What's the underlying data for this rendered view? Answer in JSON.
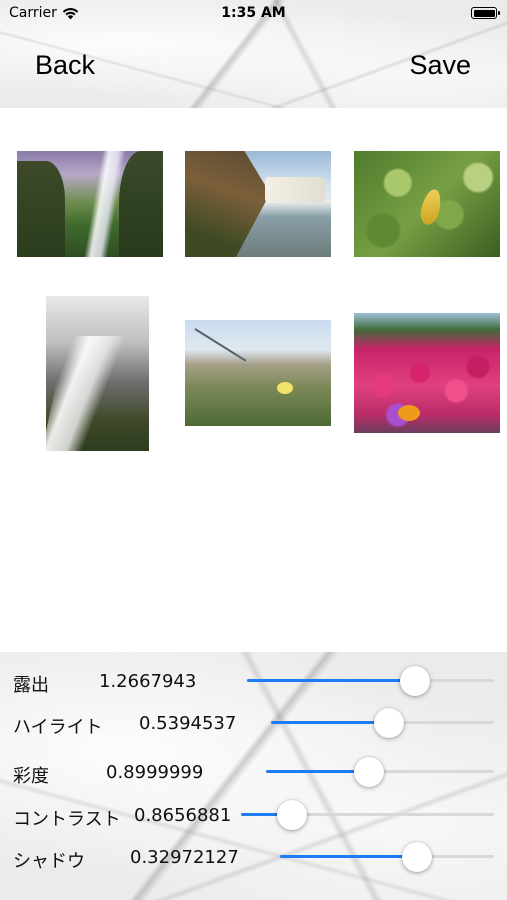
{
  "status_bar": {
    "carrier": "Carrier",
    "time": "1:35 AM",
    "wifi_icon": "wifi-icon",
    "battery_icon": "battery-icon"
  },
  "nav": {
    "back_label": "Back",
    "save_label": "Save"
  },
  "thumbnails": [
    {
      "name": "waterfall-misty-cliffs"
    },
    {
      "name": "waterfall-rocky-shore"
    },
    {
      "name": "green-leaves-yellow-leaf"
    },
    {
      "name": "stream-cascade"
    },
    {
      "name": "meadow-yellow-flower"
    },
    {
      "name": "pink-flower-field"
    }
  ],
  "adjustments": [
    {
      "label": "露出",
      "value": "1.2667943",
      "level": 0.68
    },
    {
      "label": "ハイライト",
      "value": "0.5394537",
      "level": 0.53
    },
    {
      "label": "彩度",
      "value": "0.8999999",
      "level": 0.45
    },
    {
      "label": "コントラスト",
      "value": "0.8656881",
      "level": 0.2
    },
    {
      "label": "シャドウ",
      "value": "0.32972127",
      "level": 0.64
    }
  ],
  "colors": {
    "accent": "#1e7cf2",
    "track": "#d8d8d8"
  }
}
